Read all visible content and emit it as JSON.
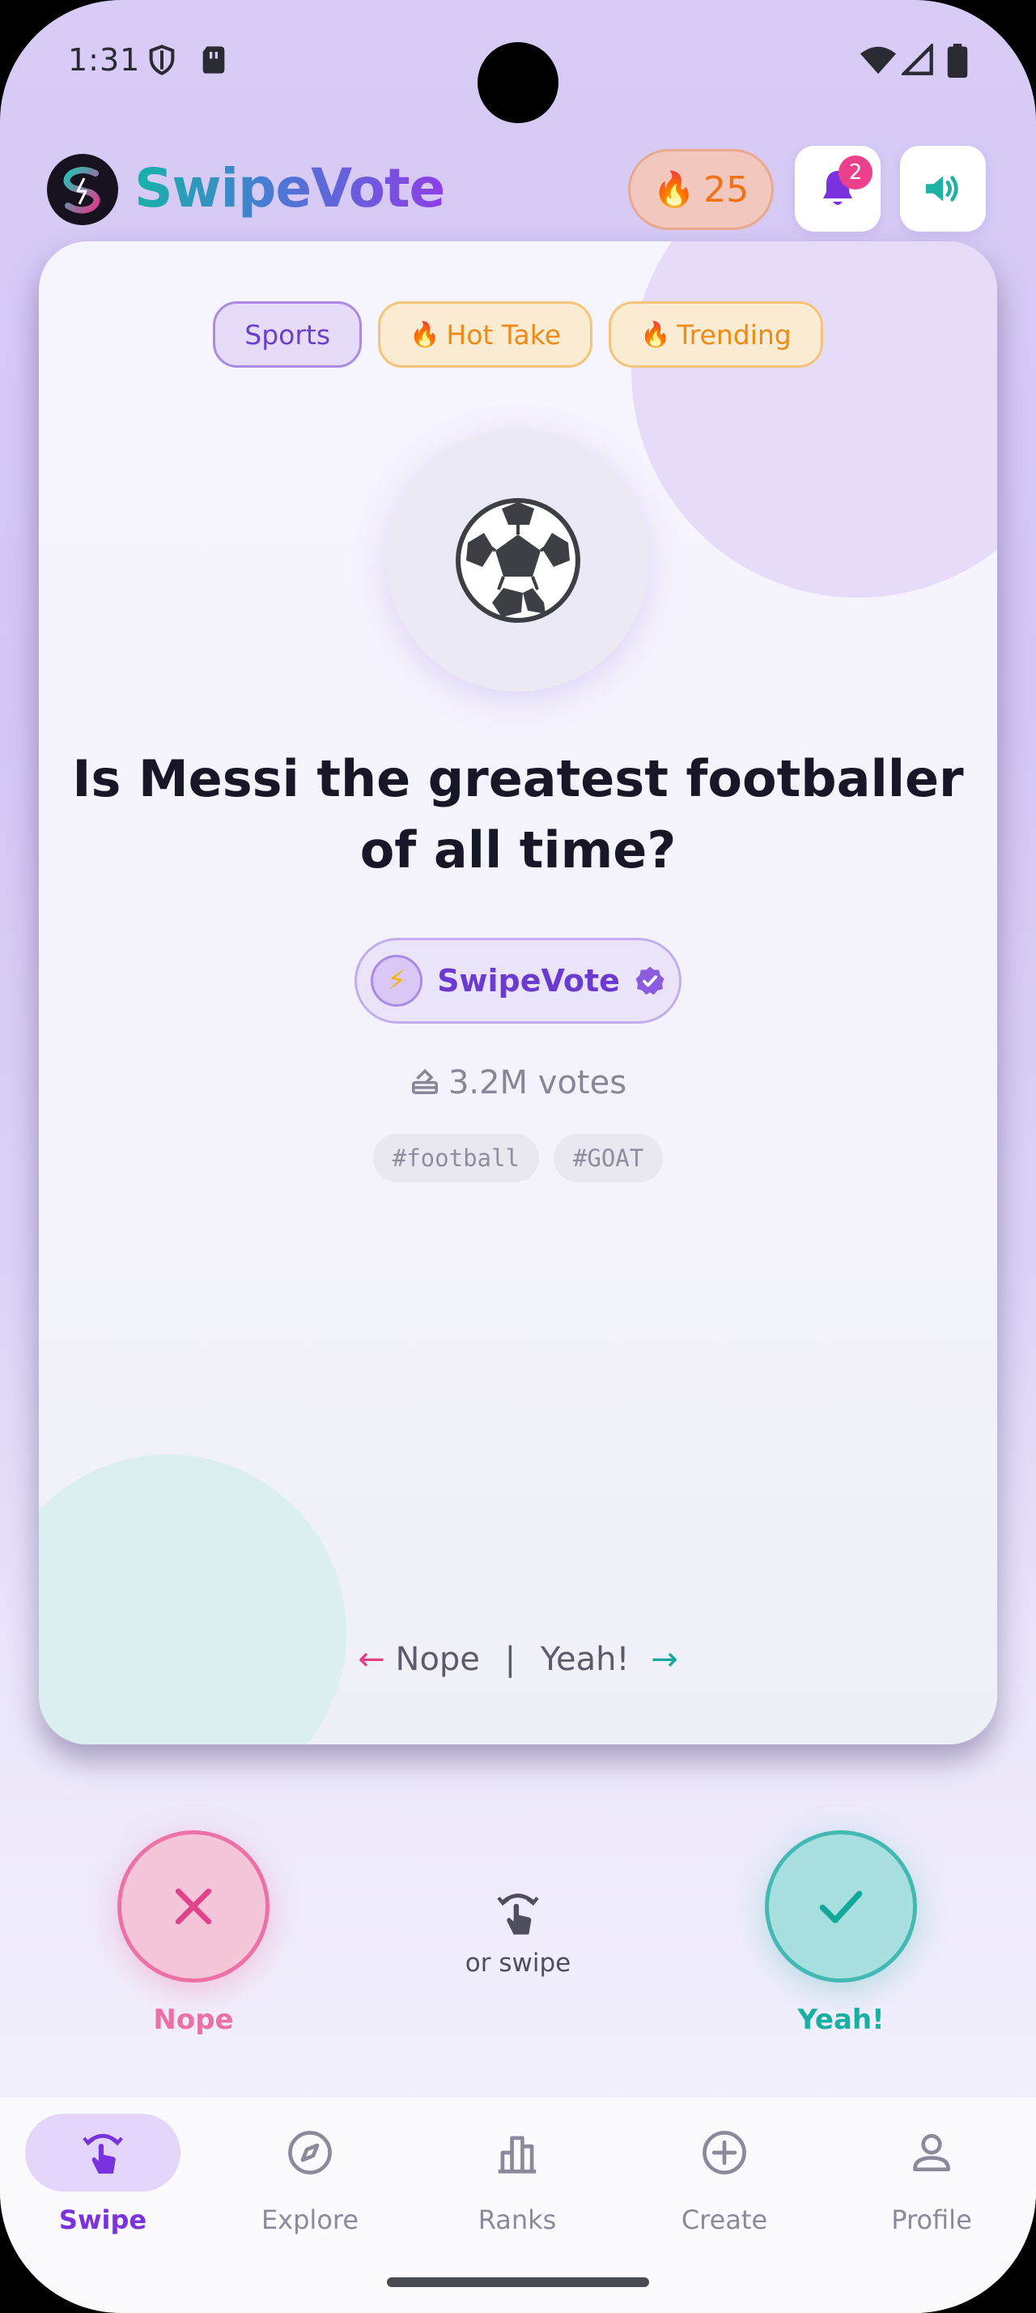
{
  "status_bar": {
    "time": "1:31",
    "icons": [
      "shield-icon",
      "sim-card-icon",
      "wifi-icon",
      "signal-icon",
      "battery-icon"
    ]
  },
  "header": {
    "brand": "SwipeVote",
    "streak": {
      "icon": "fire-icon",
      "count": "25"
    },
    "notifications": {
      "icon": "bell-icon",
      "badge": "2"
    },
    "sound": {
      "icon": "speaker-icon"
    }
  },
  "card": {
    "chips": [
      {
        "label": "Sports",
        "icon": ""
      },
      {
        "label": "Hot Take",
        "icon": "fire-icon"
      },
      {
        "label": "Trending",
        "icon": "fire-icon"
      }
    ],
    "emoji": "⚽",
    "question": "Is Messi the greatest footballer of all time?",
    "author": {
      "name": "SwipeVote",
      "avatar": "⚡",
      "verified": true
    },
    "votes": "3.2M votes",
    "tags": [
      "#football",
      "#GOAT"
    ],
    "hint": {
      "left_arrow": "←",
      "left": "Nope",
      "divider": "|",
      "right": "Yeah!",
      "right_arrow": "→"
    }
  },
  "actions": {
    "nope": {
      "label": "Nope"
    },
    "yeah": {
      "label": "Yeah!"
    },
    "swipe_hint": "or swipe"
  },
  "nav": [
    {
      "label": "Swipe",
      "icon": "swipe-icon",
      "active": true
    },
    {
      "label": "Explore",
      "icon": "compass-icon",
      "active": false
    },
    {
      "label": "Ranks",
      "icon": "bar-chart-icon",
      "active": false
    },
    {
      "label": "Create",
      "icon": "plus-circle-icon",
      "active": false
    },
    {
      "label": "Profile",
      "icon": "person-icon",
      "active": false
    }
  ],
  "colors": {
    "primary": "#7a32de",
    "nope": "#ec71a6",
    "yeah": "#44b8b2",
    "streak": "#f07118"
  }
}
